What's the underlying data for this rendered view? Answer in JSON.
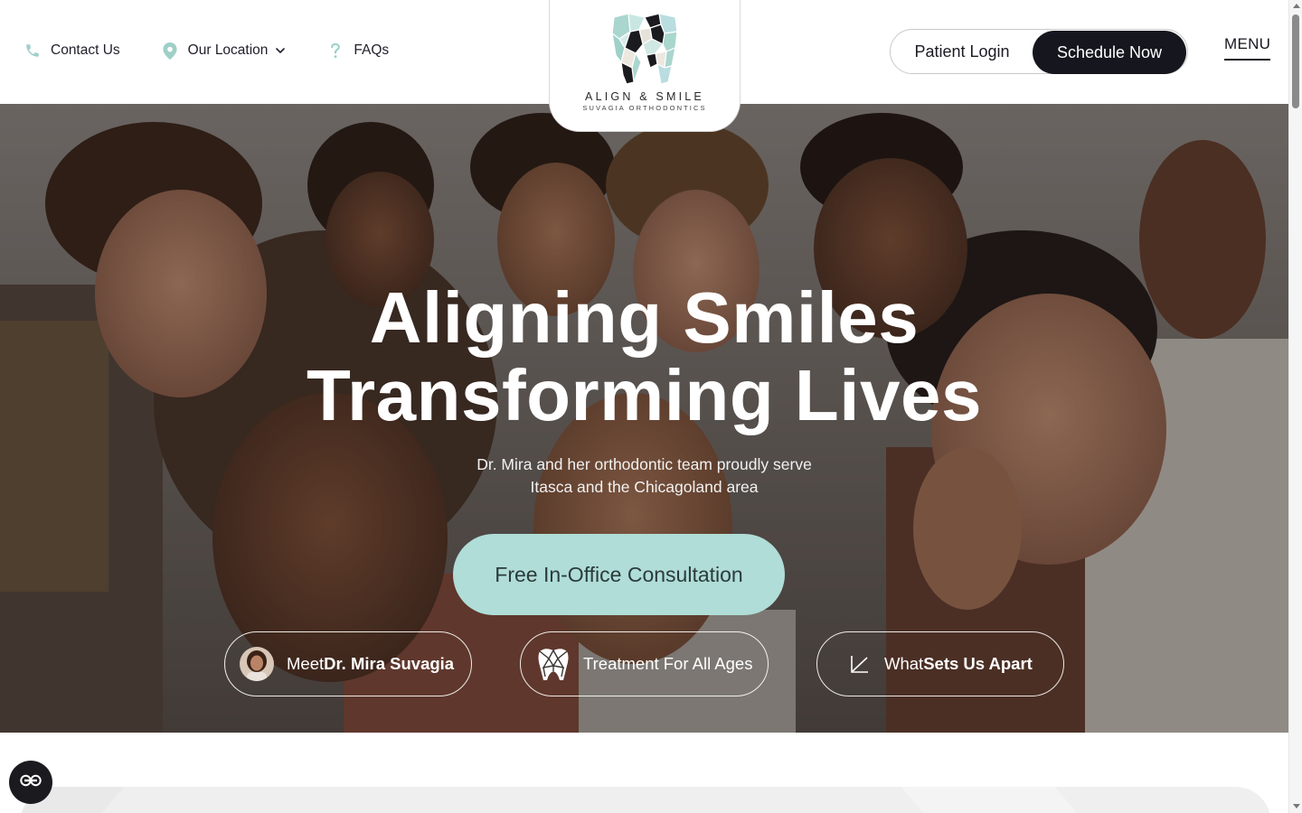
{
  "header": {
    "utility_nav": [
      {
        "label": "Contact Us",
        "icon": "phone-icon"
      },
      {
        "label": "Our Location",
        "icon": "map-pin-icon",
        "dropdown": true
      },
      {
        "label": "FAQs",
        "icon": "question-icon"
      }
    ],
    "logo": {
      "name": "ALIGN & SMILE",
      "subtitle": "SUVAGIA ORTHODONTICS"
    },
    "patient_login": "Patient Login",
    "schedule_now": "Schedule Now",
    "menu": "MENU"
  },
  "hero": {
    "title_line1": "Aligning Smiles",
    "title_line2": "Transforming Lives",
    "subtitle_line1": "Dr. Mira and her orthodontic team proudly serve",
    "subtitle_line2": "Itasca and the Chicagoland area",
    "cta": "Free In-Office Consultation",
    "pills": [
      {
        "prefix": "Meet ",
        "bold": "Dr. Mira Suvagia",
        "icon": "doctor-avatar"
      },
      {
        "prefix": "Treatment For All Ages",
        "bold": "",
        "icon": "tooth-icon"
      },
      {
        "prefix": "What ",
        "bold": "Sets Us Apart",
        "icon": "chart-line-icon"
      }
    ]
  },
  "accessibility": {
    "icon": "accessibility-icon"
  },
  "colors": {
    "brand_dark": "#16161f",
    "accent_mint": "#b0ddd7",
    "text_dark": "#1a1a22"
  }
}
